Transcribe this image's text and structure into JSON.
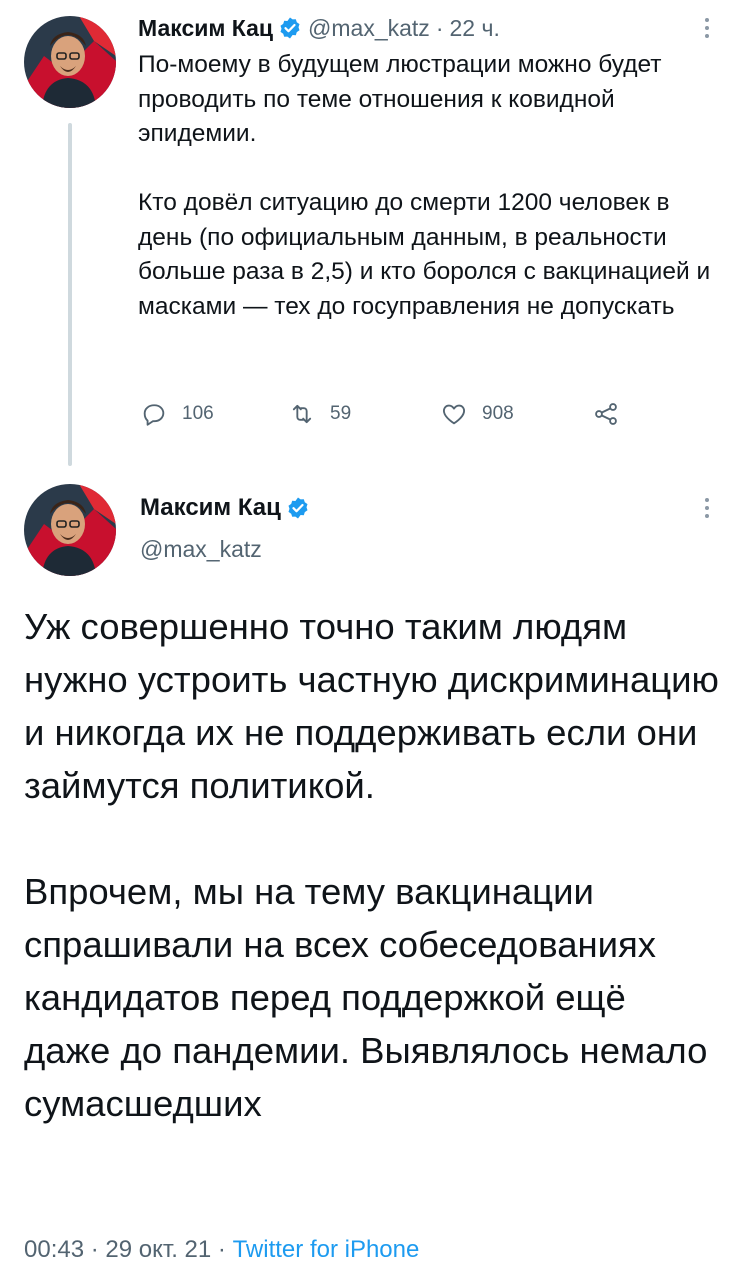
{
  "colors": {
    "verified_blue": "#1d9bf0",
    "secondary_text": "#536471",
    "primary_text": "#0f1419",
    "link": "#1d9bf0",
    "thread_line": "#cfd9de"
  },
  "tweet_reply_parent": {
    "author": {
      "name": "Максим Кац",
      "handle": "@max_katz",
      "verified": true,
      "avatar_icon": "profile-photo"
    },
    "separator": "·",
    "time": "22 ч.",
    "text": "По-моему в будущем люстрации можно будет проводить по теме отношения к ковидной эпидемии.\n\nКто довёл ситуацию до смерти 1200 человек в день (по официальным данным, в реальности больше раза в 2,5) и кто боролся с вакцинацией и масками — тех до госуправления не допускать",
    "actions": {
      "replies": "106",
      "retweets": "59",
      "likes": "908",
      "reply_icon": "comment-icon",
      "retweet_icon": "retweet-icon",
      "like_icon": "heart-icon",
      "share_icon": "share-icon"
    }
  },
  "tweet_main": {
    "author": {
      "name": "Максим Кац",
      "handle": "@max_katz",
      "verified": true,
      "avatar_icon": "profile-photo"
    },
    "text": "Уж совершенно точно таким людям нужно устроить частную дискриминацию и никогда их не поддерживать если они займутся политикой.\n\nВпрочем, мы на тему вакцинации спрашивали на всех собеседованиях кандидатов перед поддержкой ещё даже до пандемии. Выявлялось немало сумасшедших",
    "time": "00:43",
    "separator1": "·",
    "date": "29 окт. 21",
    "separator2": "·",
    "source": "Twitter for iPhone"
  }
}
